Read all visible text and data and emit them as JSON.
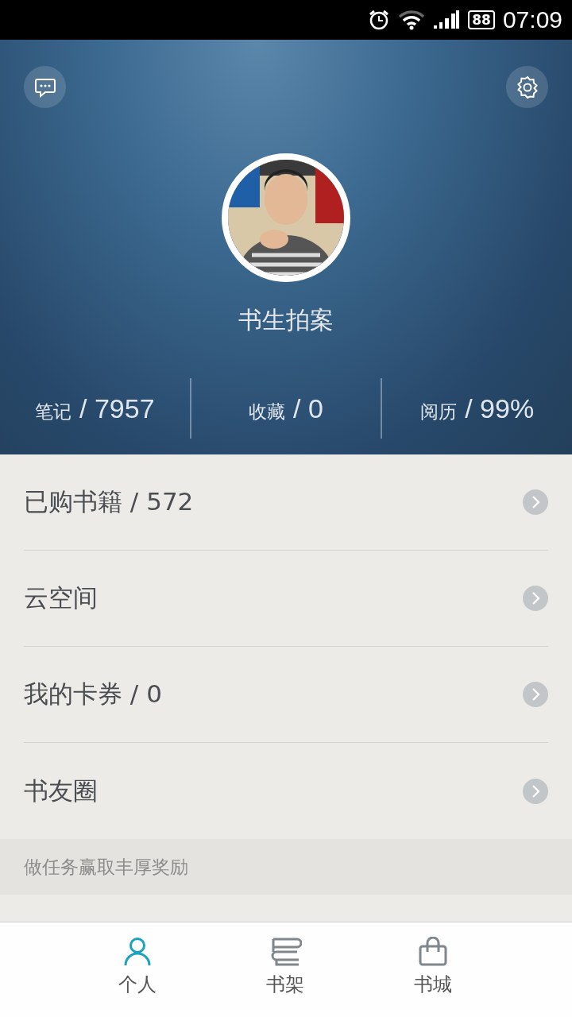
{
  "status_bar": {
    "battery": "88",
    "time": "07:09"
  },
  "profile": {
    "name": "书生拍案"
  },
  "stats": [
    {
      "label": "笔记",
      "value": "/ 7957"
    },
    {
      "label": "收藏",
      "value": "/ 0"
    },
    {
      "label": "阅历",
      "value": "/ 99%"
    }
  ],
  "menu": [
    {
      "label": "已购书籍 / 572"
    },
    {
      "label": "云空间"
    },
    {
      "label": "我的卡券 / 0"
    },
    {
      "label": "书友圈"
    }
  ],
  "section_title": "做任务赢取丰厚奖励",
  "bottom_nav": [
    {
      "label": "个人",
      "kind": "person",
      "selected": true
    },
    {
      "label": "书架",
      "kind": "shelf",
      "selected": false
    },
    {
      "label": "书城",
      "kind": "bag",
      "selected": false
    }
  ]
}
